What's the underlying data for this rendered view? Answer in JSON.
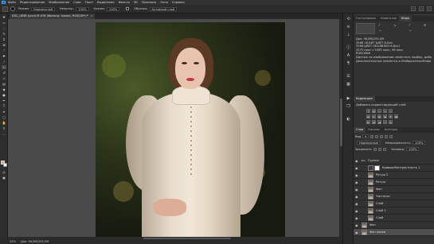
{
  "menubar": {
    "logo": "Ps",
    "items": [
      "Файл",
      "Редактирование",
      "Изображение",
      "Слои",
      "Текст",
      "Выделение",
      "Фильтр",
      "3D",
      "Просмотр",
      "Окно",
      "Справка"
    ]
  },
  "options": {
    "mode_label": "Режим:",
    "mode_value": "Нормальный",
    "opacity_label": "Непрозр.:",
    "opacity_value": "100%",
    "flow_label": "Нажим:",
    "flow_value": "100%",
    "sample_label": "Образец:",
    "sample_value": "Активный слой"
  },
  "document": {
    "tab_title": "DSC_0838 Lynch-M-076 (Фильтр: жалко, RGB/16*) *",
    "tab_close": "×"
  },
  "status": {
    "zoom": "25%",
    "doc_info": "Док: 96,8М/255,5М"
  },
  "navigator": {
    "tabs": [
      "Гистограмма",
      "Навигатор",
      "Инфо"
    ],
    "info_lines": [
      "Док: 96,8М/255,5М",
      "3568 16-БИТ ЦВЕТ 8-Бит.",
      "3568 ЦВЕТ ОБЪЯВЛЕН 8-Бит)",
      "3575 пикс x 5365 пикс, 96 пикс",
      "RGB/16bit",
      "",
      "Щелчок на изображении поместить подбор, добавьте",
      "Дополнительные элементы в Изображение/Инфо"
    ]
  },
  "adjustments": {
    "tabs": [
      "Коррекция"
    ],
    "subtitle": "Добавить корректирующий слой"
  },
  "layers": {
    "tabs": [
      "Слои",
      "Каналы",
      "Контуры"
    ],
    "search_label": "Вид",
    "blend_mode": "Нормальные",
    "opacity_label": "Непрозрачность:",
    "opacity_value": "100%",
    "lock_label": "Закрепить:",
    "fill_label": "Заливка:",
    "fill_value": "100%",
    "items": [
      {
        "name": "Группа",
        "kind": "group"
      },
      {
        "name": "Кривые/Контрастность 1",
        "kind": "adj"
      },
      {
        "name": "Ретуш 2",
        "kind": "photo"
      },
      {
        "name": "Ретуш",
        "kind": "photo"
      },
      {
        "name": "Фон",
        "kind": "photo"
      },
      {
        "name": "Частотки",
        "kind": "photo"
      },
      {
        "name": "Слой",
        "kind": "photo"
      },
      {
        "name": "Слой 1",
        "kind": "photo"
      },
      {
        "name": "Слой",
        "kind": "photo"
      },
      {
        "name": "Фон",
        "kind": "photo"
      },
      {
        "name": "Фон копия",
        "kind": "photo"
      }
    ]
  },
  "colors": {
    "foreground": "#c9a48a",
    "background": "#ffffff",
    "accent": "#31a8ff"
  }
}
